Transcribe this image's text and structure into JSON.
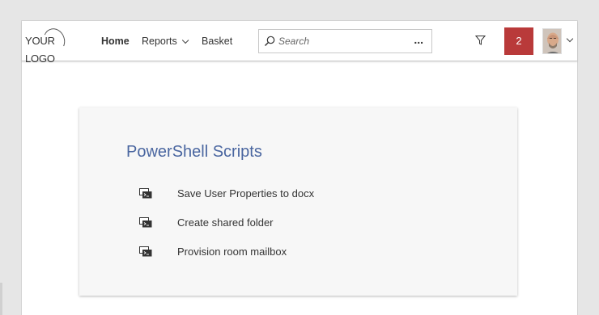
{
  "header": {
    "logo_text": "YOUR LOGO",
    "nav": {
      "home": "Home",
      "reports": "Reports",
      "basket": "Basket"
    },
    "search": {
      "placeholder": "Search",
      "more": "..."
    },
    "notification_count": "2",
    "colors": {
      "badge": "#b93a3a",
      "title": "#4a66a0"
    },
    "icons": [
      "search-icon",
      "filter-icon",
      "chevron-down-icon",
      "avatar"
    ]
  },
  "main": {
    "title": "PowerShell Scripts",
    "scripts": [
      {
        "label": "Save User Properties to docx",
        "icon": "powershell-script-icon"
      },
      {
        "label": "Create shared folder",
        "icon": "powershell-script-icon"
      },
      {
        "label": "Provision room mailbox",
        "icon": "powershell-script-icon"
      }
    ]
  }
}
